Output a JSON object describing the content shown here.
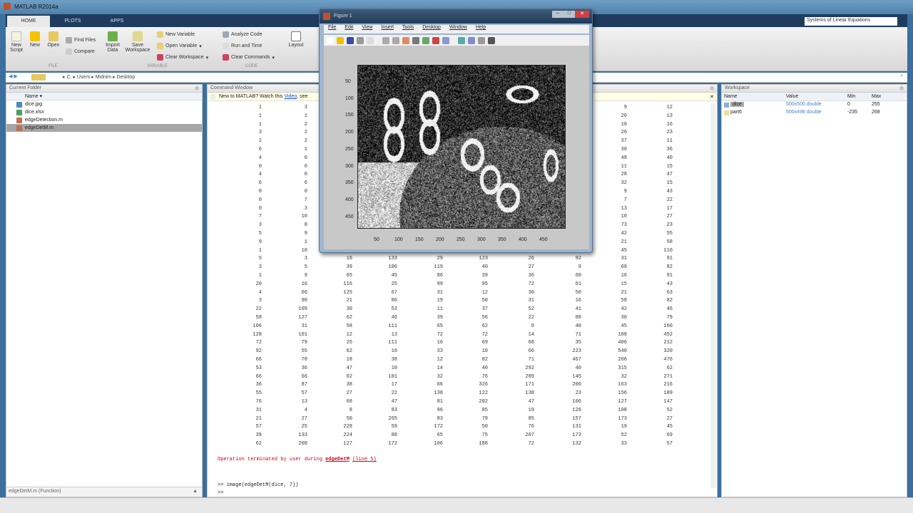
{
  "app": {
    "title": "MATLAB R2014a"
  },
  "tabs": [
    "HOME",
    "PLOTS",
    "APPS"
  ],
  "search_value": "Systems of Linear Equations",
  "ribbon": {
    "new_script": "New Script",
    "new": "New",
    "open": "Open",
    "find_files": "Find Files",
    "compare": "Compare",
    "import_data": "Import Data",
    "save_workspace": "Save Workspace",
    "new_variable": "New Variable",
    "open_variable": "Open Variable",
    "clear_workspace": "Clear Workspace",
    "analyze_code": "Analyze Code",
    "run_and_time": "Run and Time",
    "clear_commands": "Clear Commands",
    "layout": "Layout",
    "sections": [
      "FILE",
      "VARIABLE",
      "CODE"
    ]
  },
  "path": [
    "C:",
    "Users",
    "Midnim",
    "Desktop"
  ],
  "current_folder": {
    "title": "Current Folder",
    "col_name": "Name",
    "files": [
      "dice.jpg",
      "dice.xlsx",
      "edgeDetection.m",
      "edgeDetM.m"
    ],
    "selected": 3,
    "details": "edgeDetM.m (Function)"
  },
  "command_window": {
    "title": "Command Window",
    "notice": "New to MATLAB? Watch this",
    "notice_link": "Video",
    "notice_tail": ", see",
    "rows": [
      [
        "1",
        "3",
        "",
        "",
        "",
        "",
        "",
        "",
        "9",
        "12"
      ],
      [
        "1",
        "1",
        "",
        "",
        "",
        "",
        "",
        "",
        "20",
        "13"
      ],
      [
        "1",
        "2",
        "",
        "",
        "",
        "",
        "",
        "",
        "10",
        "16"
      ],
      [
        "3",
        "2",
        "",
        "",
        "",
        "",
        "",
        "",
        "26",
        "23"
      ],
      [
        "2",
        "2",
        "",
        "",
        "",
        "",
        "",
        "",
        "37",
        "11"
      ],
      [
        "6",
        "1",
        "",
        "",
        "",
        "",
        "",
        "",
        "30",
        "36"
      ],
      [
        "4",
        "0",
        "",
        "",
        "",
        "",
        "",
        "",
        "48",
        "40"
      ],
      [
        "0",
        "6",
        "",
        "",
        "",
        "",
        "",
        "",
        "11",
        "15"
      ],
      [
        "4",
        "0",
        "",
        "",
        "",
        "",
        "",
        "",
        "28",
        "47"
      ],
      [
        "6",
        "6",
        "",
        "",
        "",
        "",
        "",
        "",
        "32",
        "15"
      ],
      [
        "8",
        "0",
        "",
        "",
        "",
        "",
        "",
        "",
        "9",
        "43"
      ],
      [
        "0",
        "7",
        "",
        "",
        "",
        "",
        "",
        "",
        "7",
        "22"
      ],
      [
        "0",
        "3",
        "",
        "",
        "",
        "",
        "",
        "",
        "13",
        "17"
      ],
      [
        "7",
        "10",
        "",
        "",
        "",
        "",
        "",
        "",
        "10",
        "27"
      ],
      [
        "3",
        "8",
        "",
        "",
        "",
        "",
        "",
        "",
        "73",
        "23"
      ],
      [
        "5",
        "9",
        "",
        "",
        "",
        "",
        "",
        "",
        "42",
        "55"
      ],
      [
        "9",
        "1",
        "",
        "",
        "",
        "",
        "",
        "",
        "21",
        "58"
      ],
      [
        "1",
        "10",
        "",
        "",
        "",
        "",
        "",
        "",
        "45",
        "110"
      ],
      [
        "5",
        "3",
        "16",
        "133",
        "29",
        "123",
        "26",
        "92",
        "31",
        "91"
      ],
      [
        "3",
        "5",
        "39",
        "106",
        "119",
        "40",
        "27",
        "9",
        "69",
        "82"
      ],
      [
        "1",
        "9",
        "65",
        "45",
        "86",
        "39",
        "36",
        "60",
        "16",
        "91"
      ],
      [
        "20",
        "16",
        "116",
        "25",
        "99",
        "95",
        "72",
        "61",
        "15",
        "43"
      ],
      [
        "4",
        "66",
        "125",
        "67",
        "31",
        "12",
        "30",
        "50",
        "21",
        "63"
      ],
      [
        "3",
        "90",
        "21",
        "86",
        "19",
        "50",
        "31",
        "16",
        "58",
        "82"
      ],
      [
        "22",
        "109",
        "30",
        "53",
        "11",
        "37",
        "52",
        "41",
        "42",
        "46"
      ],
      [
        "58",
        "127",
        "62",
        "46",
        "39",
        "56",
        "22",
        "88",
        "30",
        "79"
      ],
      [
        "106",
        "31",
        "58",
        "111",
        "65",
        "62",
        "9",
        "40",
        "45",
        "160"
      ],
      [
        "128",
        "101",
        "12",
        "13",
        "72",
        "72",
        "14",
        "71",
        "108",
        "452"
      ],
      [
        "72",
        "79",
        "25",
        "111",
        "16",
        "69",
        "68",
        "35",
        "406",
        "212"
      ],
      [
        "92",
        "55",
        "62",
        "16",
        "33",
        "10",
        "66",
        "223",
        "540",
        "320"
      ],
      [
        "66",
        "78",
        "18",
        "38",
        "12",
        "82",
        "71",
        "467",
        "206",
        "476"
      ],
      [
        "53",
        "36",
        "47",
        "10",
        "14",
        "40",
        "292",
        "40",
        "315",
        "62"
      ],
      [
        "66",
        "66",
        "62",
        "101",
        "32",
        "76",
        "289",
        "145",
        "32",
        "271"
      ],
      [
        "36",
        "87",
        "38",
        "17",
        "66",
        "326",
        "171",
        "206",
        "163",
        "216"
      ],
      [
        "55",
        "57",
        "27",
        "22",
        "138",
        "122",
        "138",
        "23",
        "156",
        "189"
      ],
      [
        "76",
        "13",
        "68",
        "47",
        "81",
        "202",
        "47",
        "106",
        "127",
        "147"
      ],
      [
        "31",
        "4",
        "8",
        "83",
        "96",
        "85",
        "19",
        "126",
        "108",
        "52"
      ],
      [
        "21",
        "27",
        "50",
        "265",
        "83",
        "79",
        "85",
        "157",
        "173",
        "27"
      ],
      [
        "57",
        "25",
        "228",
        "59",
        "172",
        "50",
        "76",
        "131",
        "19",
        "45"
      ],
      [
        "39",
        "133",
        "224",
        "88",
        "65",
        "75",
        "207",
        "173",
        "52",
        "69"
      ],
      [
        "62",
        "208",
        "127",
        "172",
        "106",
        "188",
        "72",
        "132",
        "33",
        "57"
      ]
    ],
    "error_text": "Operation terminated by user during",
    "error_func": "edgeDetM",
    "error_line": "(line 5)",
    "history": ">> image(edgeDetM(dice, 7))",
    "prompt": ">>"
  },
  "workspace": {
    "title": "Workspace",
    "cols": [
      "Name",
      "Value",
      "Min",
      "Max"
    ],
    "vars": [
      {
        "name": "dice",
        "value": "500x500 double",
        "min": "0",
        "max": "255"
      },
      {
        "name": "part6",
        "value": "500x498 double",
        "min": "-235",
        "max": "268"
      }
    ]
  },
  "figure": {
    "title": "Figure 1",
    "menu": [
      "File",
      "Edit",
      "View",
      "Insert",
      "Tools",
      "Desktop",
      "Window",
      "Help"
    ],
    "xticks": [
      "50",
      "100",
      "150",
      "200",
      "250",
      "300",
      "350",
      "400",
      "450"
    ],
    "yticks": [
      "50",
      "100",
      "150",
      "200",
      "250",
      "300",
      "350",
      "400",
      "450"
    ]
  }
}
